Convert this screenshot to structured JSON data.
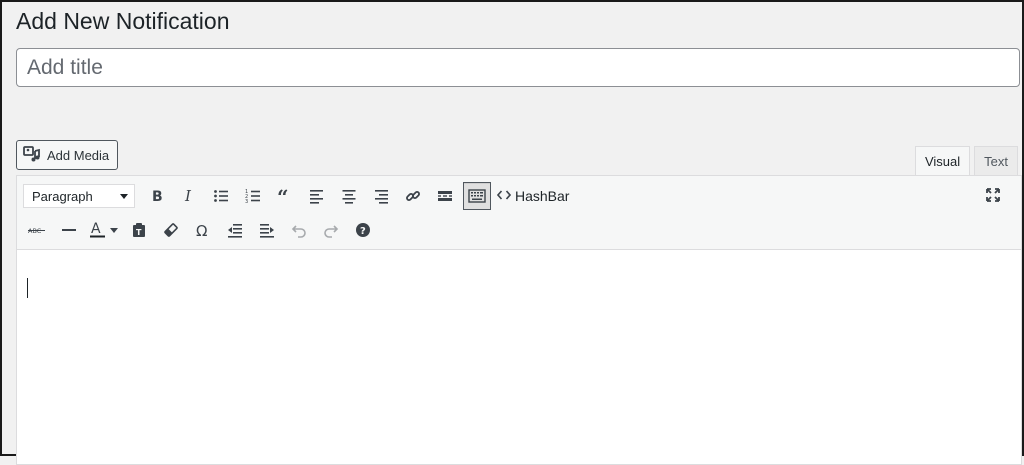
{
  "page": {
    "title": "Add New Notification"
  },
  "title_field": {
    "placeholder": "Add title",
    "value": ""
  },
  "add_media": {
    "label": "Add Media",
    "icon": "media-icon"
  },
  "editor_tabs": [
    {
      "label": "Visual",
      "active": true
    },
    {
      "label": "Text",
      "active": false
    }
  ],
  "toolbar": {
    "format_select": {
      "value": "Paragraph"
    },
    "row1": [
      "bold-icon",
      "italic-icon",
      "bullet-list-icon",
      "numbered-list-icon",
      "blockquote-icon",
      "align-left-icon",
      "align-center-icon",
      "align-right-icon",
      "link-icon",
      "read-more-icon",
      "toolbar-toggle-icon"
    ],
    "hashbar_label": "HashBar",
    "row2": [
      "strikethrough-icon",
      "horizontal-line-icon",
      "text-color-icon",
      "paste-as-text-icon",
      "clear-formatting-icon",
      "special-character-icon",
      "outdent-icon",
      "indent-icon",
      "undo-icon",
      "redo-icon",
      "help-icon"
    ],
    "fullscreen_icon": "fullscreen-icon"
  },
  "colors": {
    "background": "#f1f1f1",
    "text": "#1d2327",
    "border": "#dcdcde"
  }
}
